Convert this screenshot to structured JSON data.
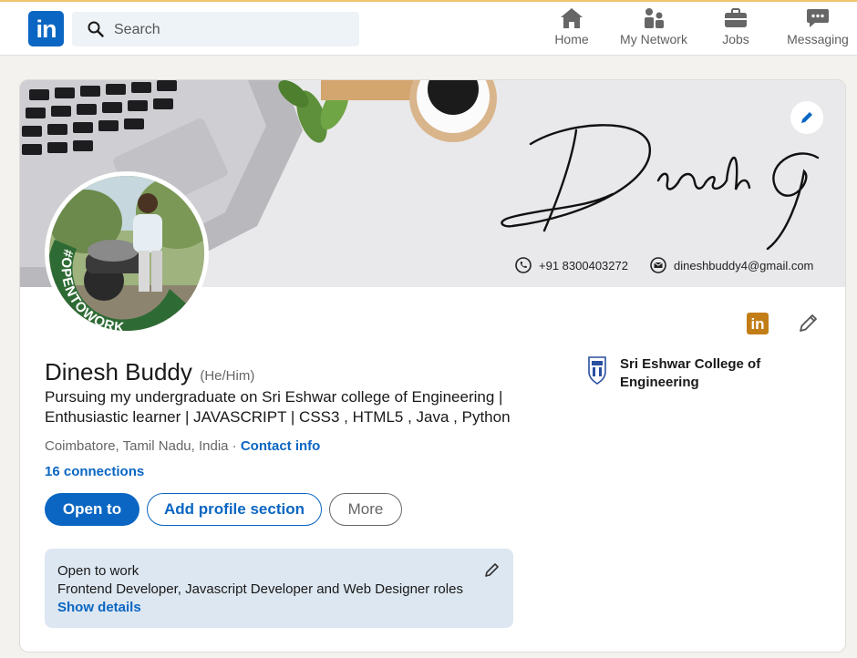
{
  "nav": {
    "logo": "in",
    "search_placeholder": "Search",
    "items": [
      {
        "label": "Home",
        "icon": "home-icon"
      },
      {
        "label": "My Network",
        "icon": "people-icon"
      },
      {
        "label": "Jobs",
        "icon": "briefcase-icon"
      },
      {
        "label": "Messaging",
        "icon": "chat-icon"
      }
    ]
  },
  "banner": {
    "signature": "Dinesh G",
    "phone": "+91 8300403272",
    "email": "dineshbuddy4@gmail.com"
  },
  "avatar": {
    "badge_text": "#OPENTOWORK"
  },
  "profile": {
    "name": "Dinesh Buddy",
    "pronouns": "(He/Him)",
    "headline": "Pursuing my undergraduate on Sri Eshwar college of Engineering | Enthusiastic learner | JAVASCRIPT | CSS3 , HTML5 , Java , Python",
    "location": "Coimbatore, Tamil Nadu, India",
    "contact_info": "Contact info",
    "connections": "16 connections",
    "school": "Sri Eshwar College of Engineering",
    "li_badge": "in"
  },
  "actions": {
    "open_to": "Open to",
    "add_section": "Add profile section",
    "more": "More"
  },
  "open_to_work": {
    "title": "Open to work",
    "roles": "Frontend Developer, Javascript Developer and Web Designer roles",
    "show_details": "Show details"
  },
  "colors": {
    "brand": "#0a66c2",
    "page_bg": "#f3f2ef",
    "otw_bg": "#dde7f1",
    "otw_ring": "#2e6b34",
    "li_badge": "#c37d16"
  }
}
